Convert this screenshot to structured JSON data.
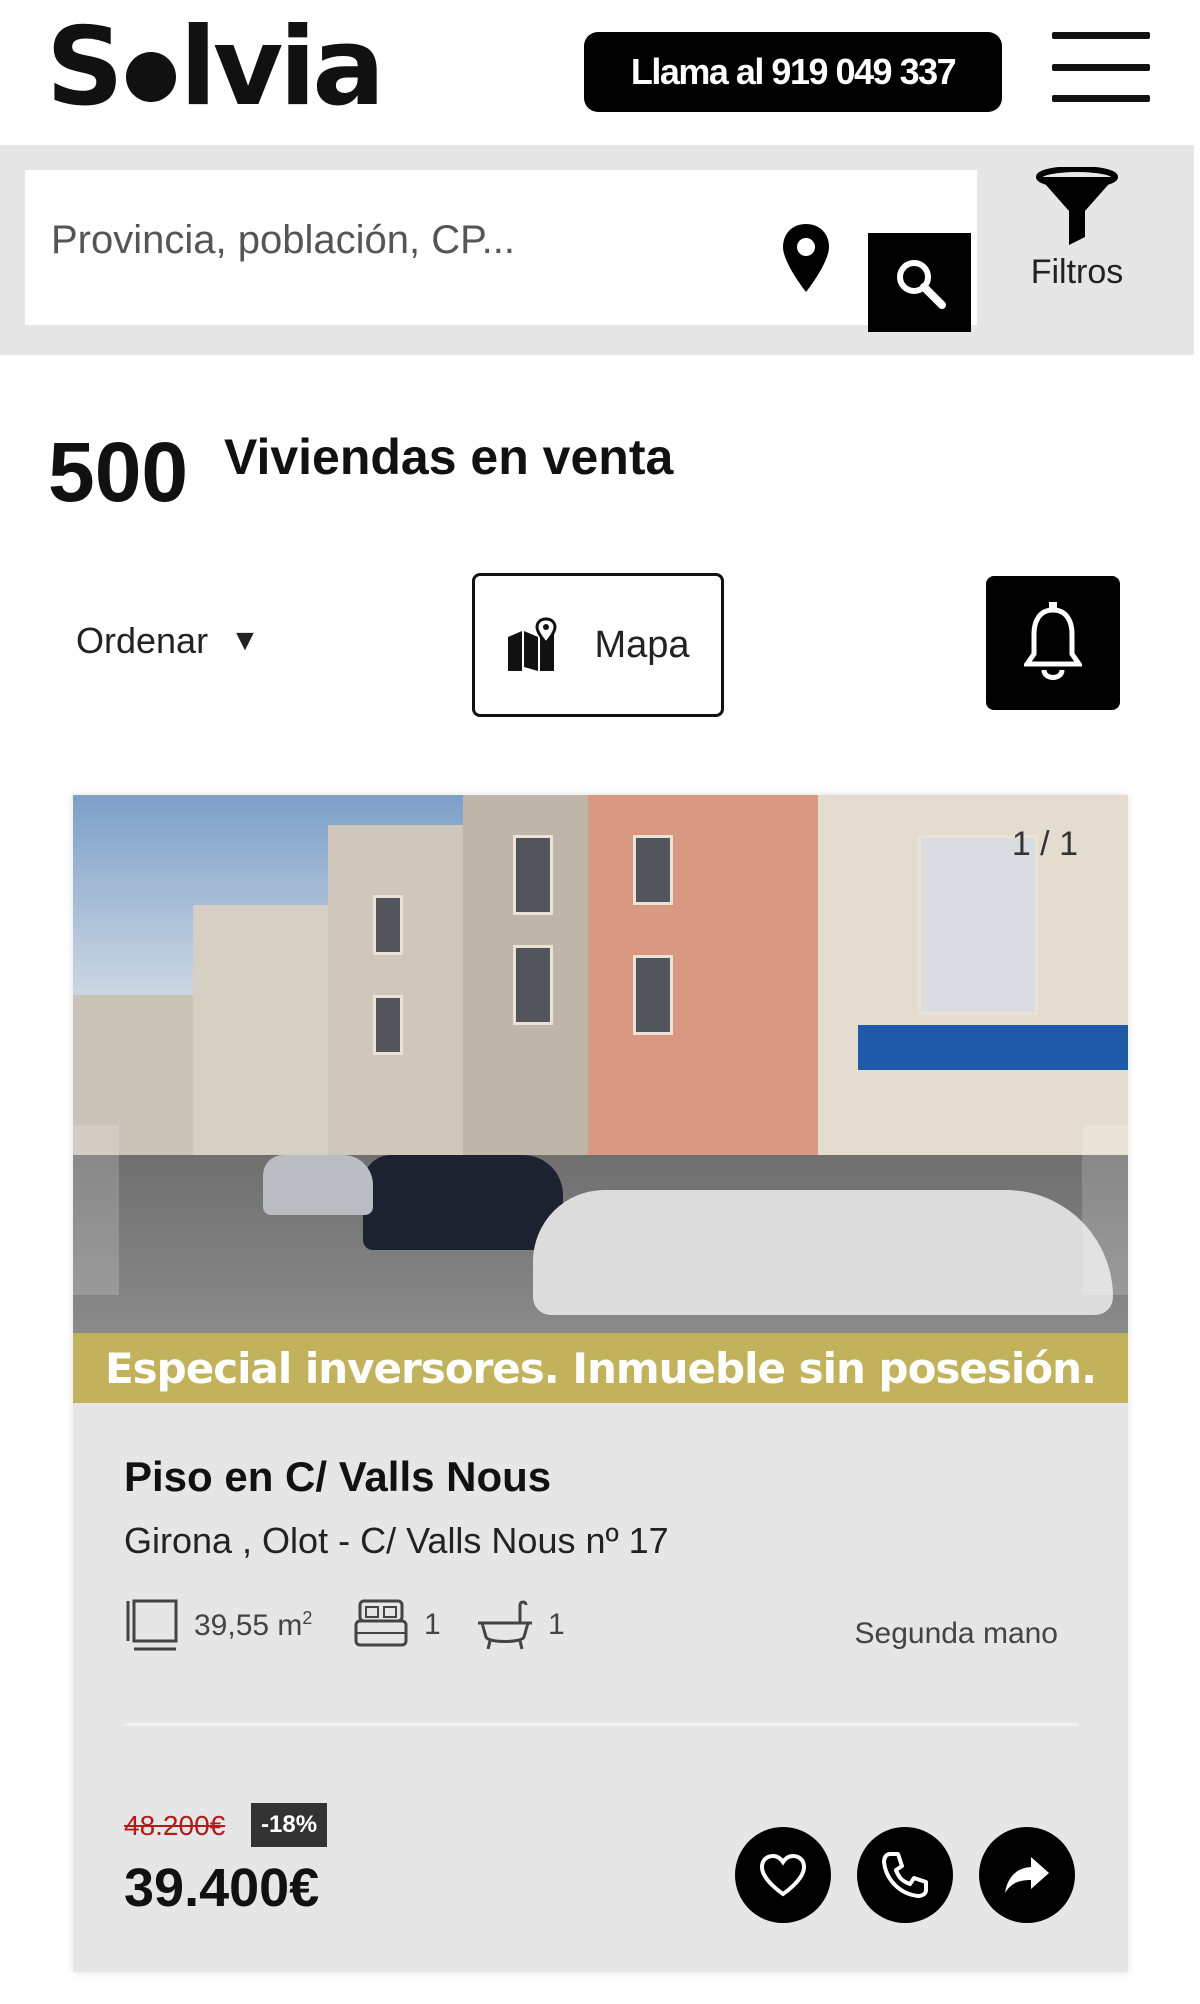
{
  "header": {
    "logo": "Solvia",
    "call_label": "Llama al 919 049 337"
  },
  "search": {
    "placeholder": "Provincia, población, CP...",
    "filters_label": "Filtros"
  },
  "results": {
    "count": "500",
    "label": "Viviendas en venta"
  },
  "toolbar": {
    "order_label": "Ordenar",
    "map_label": "Mapa"
  },
  "listing": {
    "photo_counter": "1 / 1",
    "promo": "Especial inversores. Inmueble sin posesión.",
    "title": "Piso en C/ Valls Nous",
    "address": "Girona , Olot - C/ Valls Nous nº 17",
    "area": "39,55 m",
    "area_unit_sup": "2",
    "bedrooms": "1",
    "bathrooms": "1",
    "condition": "Segunda mano",
    "old_price": "48.200€",
    "discount": "-18%",
    "price": "39.400€"
  },
  "icons": [
    "map-pin-icon",
    "search-icon",
    "filter-funnel-icon",
    "map-icon",
    "bell-icon",
    "area-icon",
    "bed-icon",
    "bath-icon",
    "heart-icon",
    "phone-icon",
    "share-icon"
  ],
  "colors": {
    "promo_band": "#c1b25b",
    "card_bg": "#e6e6e6",
    "old_price": "#b41a1a",
    "primary": "#000000"
  }
}
